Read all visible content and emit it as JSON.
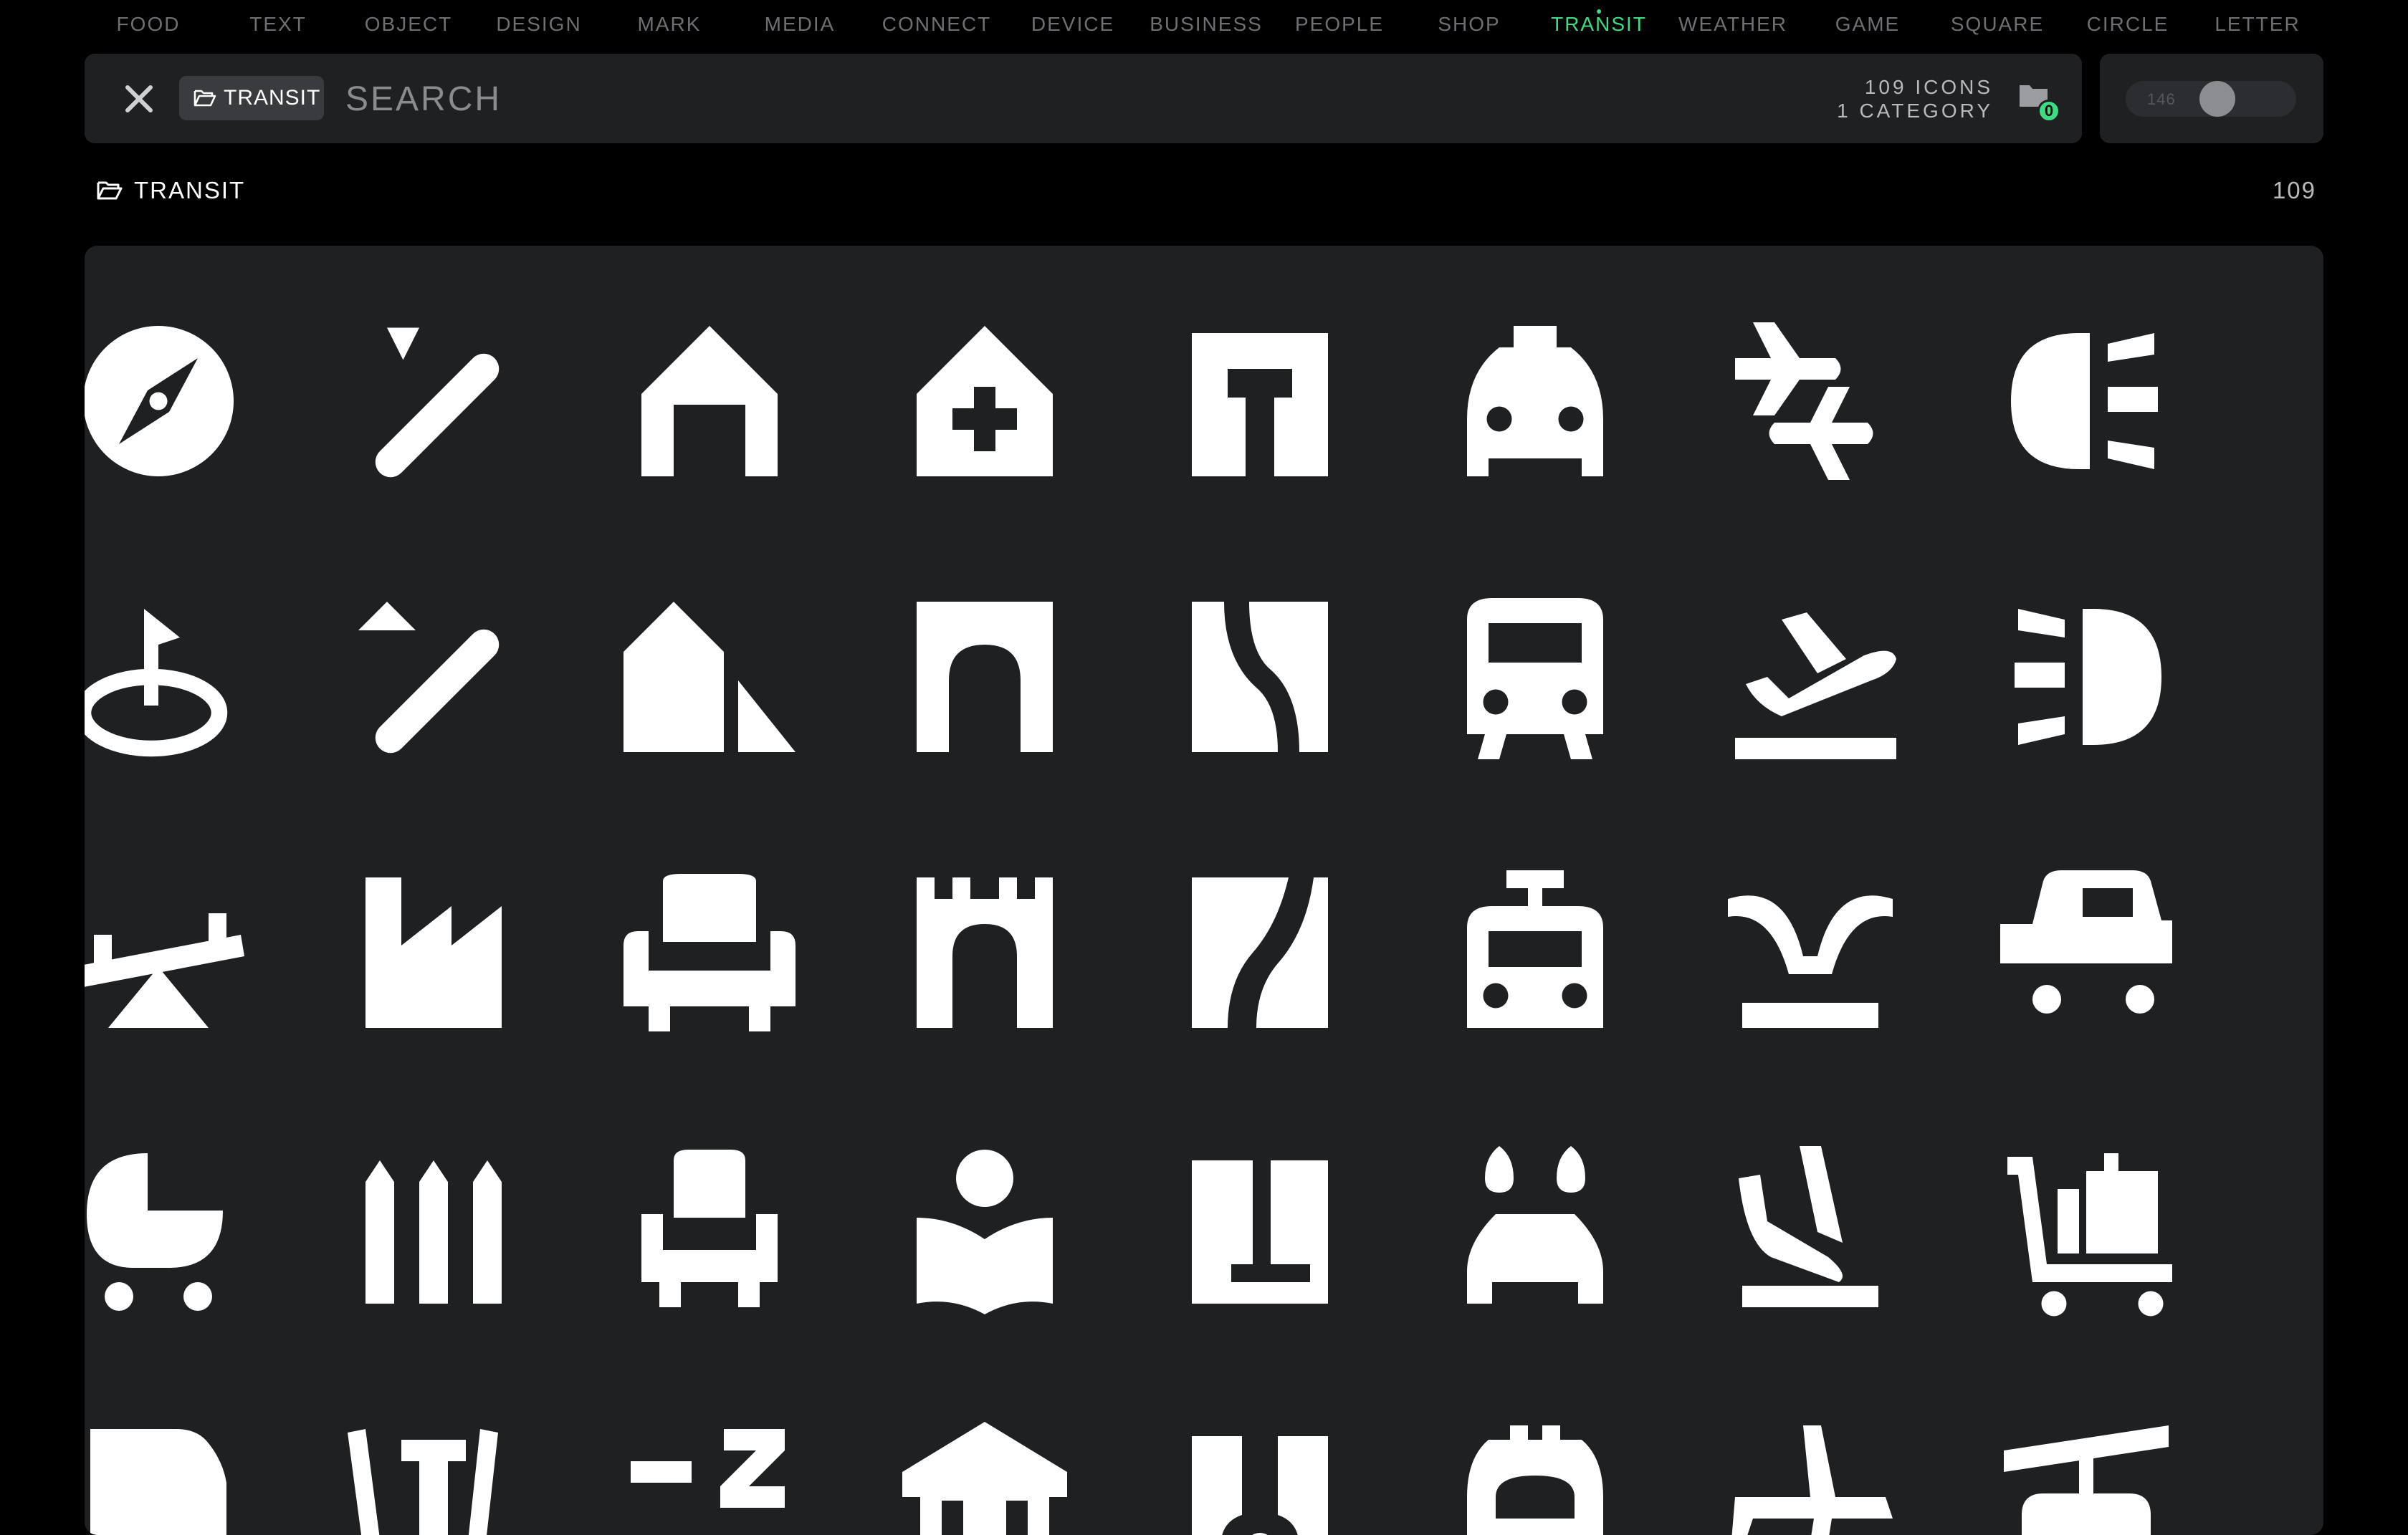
{
  "colors": {
    "accent": "#3ddc84",
    "panel": "#1f2022",
    "icon": "#ffffff"
  },
  "categories": [
    {
      "label": "FOOD",
      "active": false
    },
    {
      "label": "TEXT",
      "active": false
    },
    {
      "label": "OBJECT",
      "active": false
    },
    {
      "label": "DESIGN",
      "active": false
    },
    {
      "label": "MARK",
      "active": false
    },
    {
      "label": "MEDIA",
      "active": false
    },
    {
      "label": "CONNECT",
      "active": false
    },
    {
      "label": "DEVICE",
      "active": false
    },
    {
      "label": "BUSINESS",
      "active": false
    },
    {
      "label": "PEOPLE",
      "active": false
    },
    {
      "label": "SHOP",
      "active": false
    },
    {
      "label": "TRANSIT",
      "active": true
    },
    {
      "label": "WEATHER",
      "active": false
    },
    {
      "label": "GAME",
      "active": false
    },
    {
      "label": "SQUARE",
      "active": false
    },
    {
      "label": "CIRCLE",
      "active": false
    },
    {
      "label": "LETTER",
      "active": false
    }
  ],
  "search": {
    "filter_chip": "TRANSIT",
    "placeholder": "SEARCH",
    "value": "",
    "icon_count": "109 ICONS",
    "category_count": "1 CATEGORY",
    "collection_count": "0"
  },
  "size_slider": {
    "value": "146",
    "level": 0.55
  },
  "section": {
    "title": "TRANSIT",
    "count": "109"
  },
  "icons": [
    "compass-icon",
    "ski-icon",
    "garage-icon",
    "hospital-icon",
    "road-t-icon",
    "taxi-icon",
    "connecting-flights-icon",
    "headlight-icon",
    "golf-icon",
    "ski-slope-icon",
    "camping-icon",
    "tunnel-icon",
    "road-curve-icon",
    "train-icon",
    "flight-takeoff-icon",
    "headlight-reverse-icon",
    "seesaw-icon",
    "factory-icon",
    "sofa-icon",
    "castle-icon",
    "road-bend-icon",
    "trolleybus-icon",
    "landing-runway-icon",
    "car-icon",
    "stroller-icon",
    "fence-icon",
    "armchair-icon",
    "reading-room-icon",
    "parking-lot-icon",
    "water-heater-icon",
    "flight-land-icon",
    "luggage-cart-icon",
    "flag-icon",
    "barrier-icon",
    "sleep-icon",
    "temple-icon",
    "tag-icon",
    "gas-station-icon",
    "airplane-icon",
    "cable-car-icon"
  ]
}
